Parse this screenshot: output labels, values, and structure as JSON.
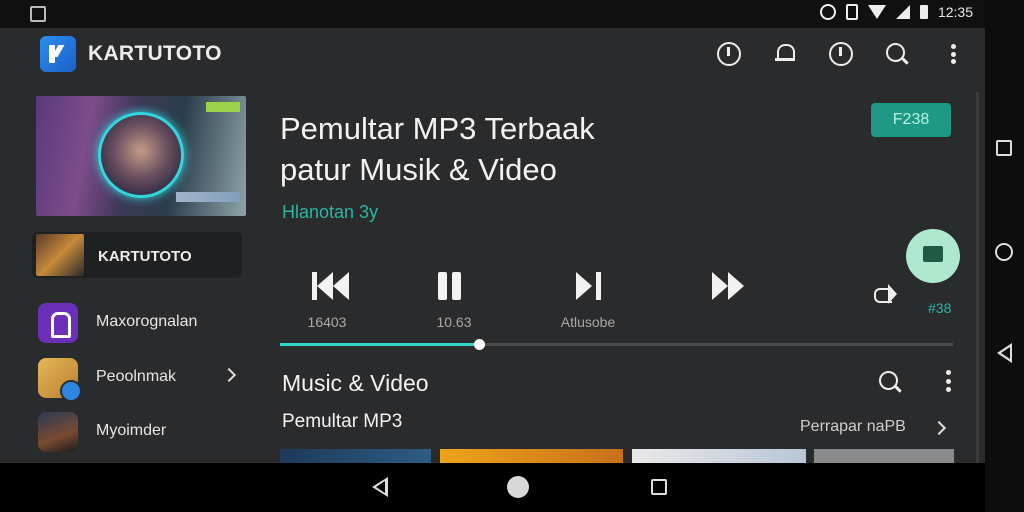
{
  "status_bar": {
    "time": "12:35"
  },
  "app": {
    "title": "KARTUTOTO"
  },
  "top_icons": [
    "info-icon",
    "bell-icon",
    "info-icon",
    "search-icon",
    "more-vert-icon"
  ],
  "sidebar": {
    "card_label": "KARTUTOTO",
    "items": [
      {
        "label": "Maxorognalan",
        "icon": "lock-app-icon",
        "has_chevron": false
      },
      {
        "label": "Peoolnmak",
        "icon": "yellow-app-icon",
        "has_chevron": true
      },
      {
        "label": "Myoimder",
        "icon": "photo-app-icon",
        "has_chevron": false
      }
    ]
  },
  "player": {
    "title_line1": "Pemultar MP3 Terbaak",
    "title_line2": "patur Musik & Video",
    "subtitle": "Hlanotan 3y ",
    "badge": "F238 ",
    "controls": [
      {
        "name": "previous",
        "label": "16403"
      },
      {
        "name": "pause",
        "label": "10.63"
      },
      {
        "name": "next",
        "label": "Atlusobe"
      },
      {
        "name": "fast-forward",
        "label": ""
      }
    ],
    "share_count": "#38",
    "progress_fraction": 0.295
  },
  "section": {
    "title": "Music & Video",
    "row_label": "Pemultar MP3",
    "row_more": "Perrapar naPB"
  },
  "colors": {
    "accent": "#27b8a2",
    "background": "#2a2b2d",
    "badge": "#1e9a84",
    "fab": "#aee8cf"
  }
}
